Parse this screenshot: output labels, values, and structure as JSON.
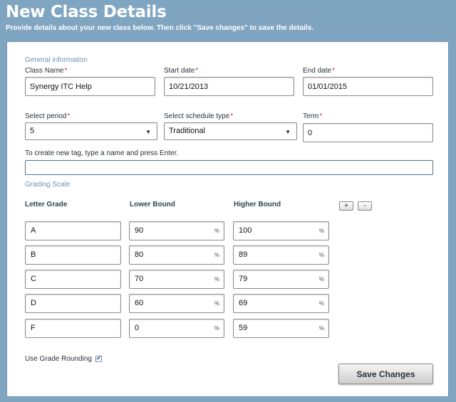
{
  "header": {
    "title": "New Class Details",
    "subtitle": "Provide details about your new class below. Then click \"Save changes\" to save the details."
  },
  "general": {
    "section_label": "General information",
    "class_name": {
      "label": "Class Name",
      "value": "Synergy ITC Help"
    },
    "start_date": {
      "label": "Start date",
      "value": "10/21/2013"
    },
    "end_date": {
      "label": "End date",
      "value": "01/01/2015"
    },
    "period": {
      "label": "Select period",
      "value": "5"
    },
    "schedule_type": {
      "label": "Select schedule type",
      "value": "Traditional"
    },
    "term": {
      "label": "Term",
      "value": "0"
    },
    "tag": {
      "label": "To create new tag, type a name and press Enter.",
      "value": ""
    },
    "required_marker": "*"
  },
  "grading": {
    "section_label": "Grading Scale",
    "col_letter": "Letter Grade",
    "col_lower": "Lower Bound",
    "col_higher": "Higher Bound",
    "add_label": "+",
    "remove_label": "-",
    "percent_sign": "%",
    "rows": [
      {
        "letter": "A",
        "lower": "90",
        "higher": "100"
      },
      {
        "letter": "B",
        "lower": "80",
        "higher": "89"
      },
      {
        "letter": "C",
        "lower": "70",
        "higher": "79"
      },
      {
        "letter": "D",
        "lower": "60",
        "higher": "69"
      },
      {
        "letter": "F",
        "lower": "0",
        "higher": "59"
      }
    ]
  },
  "rounding": {
    "label": "Use Grade Rounding",
    "checked": true,
    "check_glyph": "✔"
  },
  "actions": {
    "save_label": "Save Changes"
  },
  "icons": {
    "caret": "▼"
  }
}
